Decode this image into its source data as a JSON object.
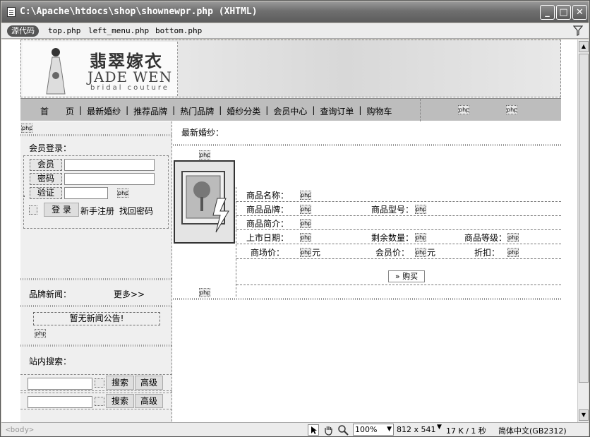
{
  "window": {
    "title": "C:\\Apache\\htdocs\\shop\\shownewpr.php (XHTML)",
    "minimize": "_",
    "maximize": "□",
    "close": "✕"
  },
  "tabs": {
    "source": "源代码",
    "files": [
      "top.php",
      "left_menu.php",
      "bottom.php"
    ]
  },
  "header": {
    "brand_cn": "翡翠嫁衣",
    "brand_en": "JADE WEN",
    "brand_sub": "bridal couture"
  },
  "nav": {
    "items": [
      "首　　页",
      "最新婚纱",
      "推荐品牌",
      "热门品牌",
      "婚纱分类",
      "会员中心",
      "查询订单",
      "购物车"
    ]
  },
  "sidebar": {
    "login_title": "会员登录：",
    "member_label": "会员",
    "password_label": "密码",
    "verify_label": "验证",
    "login_button": "登 录",
    "register_link": "新手注册",
    "recover_link": "找回密码",
    "news_title": "品牌新闻：",
    "more_link": "更多>>",
    "no_news": "暂无新闻公告!",
    "search_title": "站内搜索：",
    "search_button": "搜索",
    "advanced_button": "高级"
  },
  "main": {
    "section_title": "最新婚纱：",
    "fields": {
      "name": "商品名称：",
      "brand": "商品品牌：",
      "model": "商品型号：",
      "intro": "商品简介：",
      "date": "上市日期：",
      "stock": "剩余数量：",
      "grade": "商品等级：",
      "market_price": "商场价：",
      "member_price": "会员价：",
      "discount": "折扣："
    },
    "yuan": "元",
    "buy_button": "» 购买"
  },
  "php_marker": "php",
  "statusbar": {
    "tag": "<body>",
    "zoom": "100%",
    "size": "812 x 541",
    "weight": "17 K / 1 秒",
    "encoding": "简体中文(GB2312)"
  }
}
